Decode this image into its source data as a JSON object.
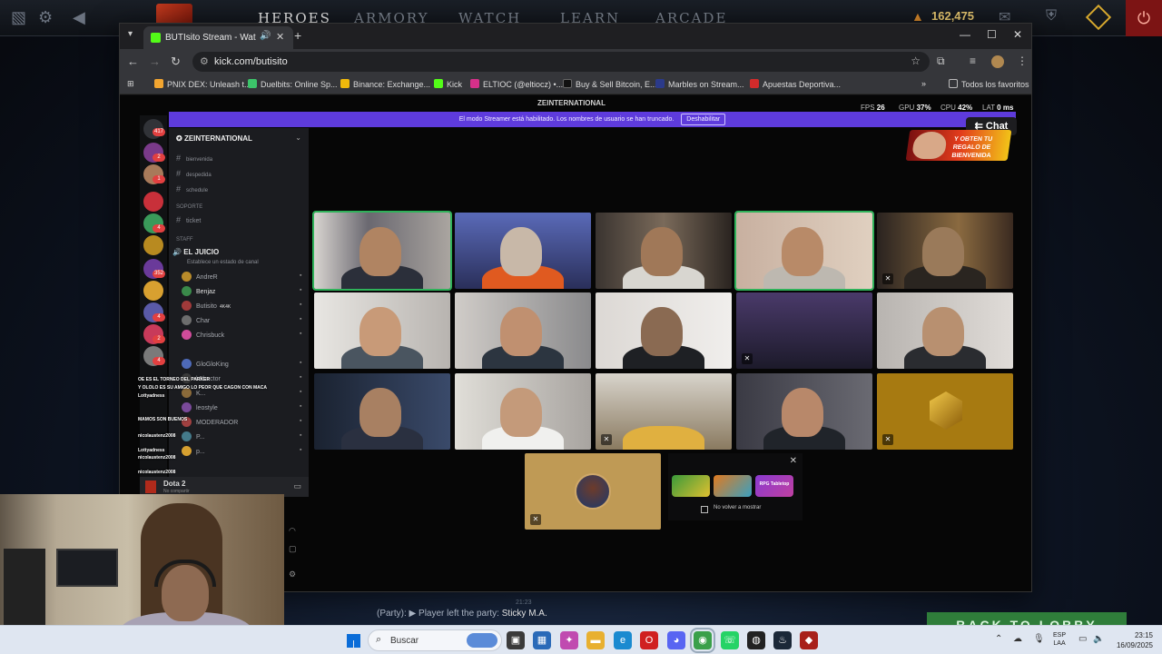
{
  "dota": {
    "nav": [
      "HEROES",
      "ARMORY",
      "WATCH",
      "LEARN",
      "ARCADE"
    ],
    "shards": "162,475",
    "party_prefix": "(Party):",
    "party_message": "Player left the party:",
    "party_player": "Sticky M.A.",
    "party_time": "21:23",
    "back_to_lobby": "BACK TO LOBBY"
  },
  "browser": {
    "tab_title": "BUTIsito Stream - Watch Live",
    "url": "kick.com/butisito",
    "bookmarks": [
      "PNIX DEX: Unleash t...",
      "Duelbits: Online Sp...",
      "Binance: Exchange...",
      "Kick",
      "ELTIOC (@eltiocz) •...",
      "Buy & Sell Bitcoin, E...",
      "Marbles on Stream...",
      "Apuestas Deportiva..."
    ],
    "all_bookmarks": "Todos los favoritos",
    "overflow": "»"
  },
  "stream": {
    "discord_title": "ZEINTERNATIONAL",
    "fps_label": "FPS",
    "fps_value": "26",
    "gpu_label": "GPU",
    "gpu_value": "37%",
    "cpu_label": "CPU",
    "cpu_value": "42%",
    "lat_label": "LAT",
    "lat_value": "0 ms",
    "banner_text": "El modo Streamer está habilitado. Los nombres de usuario se han truncado.",
    "banner_button": "Deshabilitar",
    "chat_button": "Chat",
    "promo_text": "Y OBTEN TU REGALO DE BIENVENIDA"
  },
  "discord": {
    "guild_badges": [
      "417",
      "2",
      "1",
      "4",
      "352",
      "4",
      "2",
      "4"
    ],
    "server_name": "ZEINTERNATIONAL",
    "channels": [
      "bienvenida",
      "despedida",
      "schedule"
    ],
    "support_category": "SOPORTE",
    "ticket_channel": "ticket",
    "staff_category": "STAFF",
    "voice_channel": "EL JUICIO",
    "voice_status": "Establece un estado de canal",
    "members": [
      {
        "name": "AndreR",
        "color": "#b98b2a"
      },
      {
        "name": "Benjaz",
        "color": "#3a8a4a"
      },
      {
        "name": "Butisito",
        "color": "#a03a3a"
      },
      {
        "name": "Char",
        "color": "#6d6d6d"
      },
      {
        "name": "Chrisbuck",
        "color": "#d04c9a"
      },
      {
        "name": "",
        "color": "#5a5a5a"
      },
      {
        "name": "GloGloKing",
        "color": "#4e6ab8"
      },
      {
        "name": "k5hector",
        "color": "#3b3b3b"
      },
      {
        "name": "K...",
        "color": "#8a6a3a"
      },
      {
        "name": "leostyle",
        "color": "#7a4a9a"
      },
      {
        "name": "MODERADOR",
        "color": "#a04040"
      },
      {
        "name": "P...",
        "color": "#447a8a"
      },
      {
        "name": "p...",
        "color": "#d6a030"
      }
    ],
    "live_tag": "4K4K",
    "chat_overlay": [
      "OE ES EL TORNEO DEL PARKER",
      "Y OLOLO ES SU AMIGO LO PEOR QUE CAGON CON MACA",
      "Lottyadness",
      "MAMOS SON BUENOS",
      "nicolaustenz2008",
      "Lottyadness",
      "nicolaustenz2008",
      "nicolaustenz2008"
    ],
    "game_name": "Dota 2",
    "game_sub": "No compartir"
  },
  "activities": {
    "labels": [
      "",
      "",
      "RPG Tabletop"
    ],
    "dont_show": "No volver a mostrar"
  },
  "taskbar": {
    "search": "Buscar",
    "lang_top": "ESP",
    "lang_bottom": "LAA",
    "time": "23:15",
    "date": "16/09/2025"
  }
}
